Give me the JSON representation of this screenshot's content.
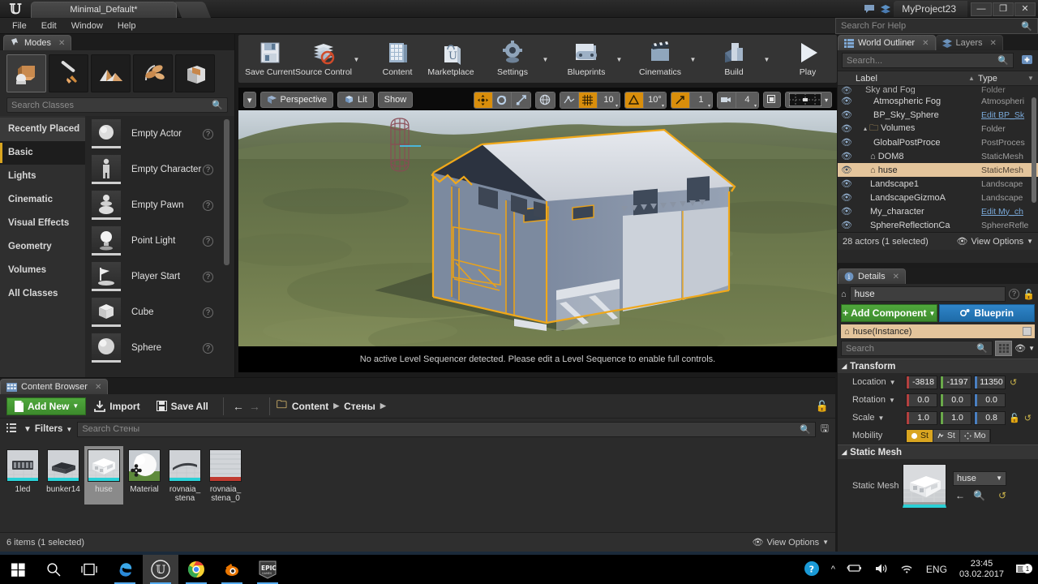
{
  "titlebar": {
    "level_tab": "Minimal_Default*",
    "project_name": "MyProject23",
    "minimize": "—",
    "maximize": "❐",
    "close": "✕",
    "chat_icon": "chat-icon",
    "cloud_icon": "layers-icon"
  },
  "menubar": {
    "items": [
      "File",
      "Edit",
      "Window",
      "Help"
    ]
  },
  "help_search": {
    "placeholder": "Search For Help",
    "icon": "search-icon"
  },
  "modes": {
    "tab_label": "Modes",
    "buttons": [
      "place-mode",
      "paint-mode",
      "landscape-mode",
      "foliage-mode",
      "geometry-mode"
    ],
    "search_placeholder": "Search Classes",
    "categories": [
      "Recently Placed",
      "Basic",
      "Lights",
      "Cinematic",
      "Visual Effects",
      "Geometry",
      "Volumes",
      "All Classes"
    ],
    "selected_category": "Basic",
    "assets": [
      "Empty Actor",
      "Empty Character",
      "Empty Pawn",
      "Point Light",
      "Player Start",
      "Cube",
      "Sphere"
    ]
  },
  "toolbar": {
    "items": [
      {
        "label": "Save Current",
        "icon": "save-icon",
        "caret": false
      },
      {
        "label": "Source Control",
        "icon": "source-control-icon",
        "caret": true
      },
      {
        "label": "Content",
        "icon": "content-icon",
        "caret": false
      },
      {
        "label": "Marketplace",
        "icon": "marketplace-icon",
        "caret": false
      },
      {
        "label": "Settings",
        "icon": "settings-gear-icon",
        "caret": true
      },
      {
        "label": "Blueprints",
        "icon": "blueprints-icon",
        "caret": true
      },
      {
        "label": "Cinematics",
        "icon": "cinematics-icon",
        "caret": true
      },
      {
        "label": "Build",
        "icon": "build-icon",
        "caret": true
      },
      {
        "label": "Play",
        "icon": "play-icon",
        "caret": true
      }
    ],
    "overflow": "»"
  },
  "viewport": {
    "view_caret": "▾",
    "perspective": "Perspective",
    "lit": "Lit",
    "show": "Show",
    "grid_snap_value": "10",
    "rotation_snap_value": "10°",
    "scale_snap_value": "1",
    "camera_speed_value": "4",
    "message": "No active Level Sequencer detected. Please edit a Level Sequence to enable full controls."
  },
  "outliner": {
    "tabs": [
      {
        "label": "World Outliner",
        "active": true
      },
      {
        "label": "Layers",
        "active": false
      }
    ],
    "search_placeholder": "Search...",
    "columns": {
      "label": "Label",
      "type": "Type"
    },
    "rows": [
      {
        "label": "Sky and Fog",
        "type": "Folder",
        "indent": 10,
        "icon": "folder-icon",
        "selected": false,
        "partial": true
      },
      {
        "label": "Atmospheric Fog",
        "type": "Atmospheri",
        "indent": 20,
        "icon": "fog-icon",
        "selected": false
      },
      {
        "label": "BP_Sky_Sphere",
        "type": "Edit BP_Sk",
        "indent": 20,
        "icon": "sphere-icon",
        "selected": false,
        "link": true
      },
      {
        "label": "Volumes",
        "type": "Folder",
        "indent": 8,
        "icon": "folder-icon",
        "selected": false
      },
      {
        "label": "GlobalPostProce",
        "type": "PostProces",
        "indent": 20,
        "icon": "volume-icon",
        "selected": false
      },
      {
        "label": "DOM8",
        "type": "StaticMesh",
        "indent": 14,
        "icon": "mesh-icon",
        "selected": false
      },
      {
        "label": "huse",
        "type": "StaticMesh",
        "indent": 14,
        "icon": "mesh-icon",
        "selected": true
      },
      {
        "label": "Landscape1",
        "type": "Landscape",
        "indent": 14,
        "icon": "landscape-icon",
        "selected": false
      },
      {
        "label": "LandscapeGizmoA",
        "type": "Landscape",
        "indent": 14,
        "icon": "gizmo-icon",
        "selected": false
      },
      {
        "label": "My_character",
        "type": "Edit My_ch",
        "indent": 14,
        "icon": "character-icon",
        "selected": false,
        "link": true
      },
      {
        "label": "SphereReflectionCa",
        "type": "SphereRefle",
        "indent": 14,
        "icon": "reflection-icon",
        "selected": false
      }
    ],
    "footer_count": "28 actors (1 selected)",
    "view_options": "View Options"
  },
  "details": {
    "tab_label": "Details",
    "actor_name": "huse",
    "add_component": "Add Component",
    "blueprint_button": "Blueprin",
    "instance_row": "huse(Instance)",
    "search_placeholder": "Search",
    "sections": {
      "transform": "Transform",
      "static_mesh": "Static Mesh"
    },
    "transform": {
      "location_label": "Location",
      "location": [
        "-3818",
        "-1197",
        "11350"
      ],
      "rotation_label": "Rotation",
      "rotation": [
        "0.0",
        "0.0",
        "0.0"
      ],
      "scale_label": "Scale",
      "scale": [
        "1.0",
        "1.0",
        "0.8"
      ],
      "mobility_label": "Mobility",
      "mobility": [
        "St",
        "St",
        "Mo"
      ],
      "mobility_selected": 0
    },
    "static_mesh": {
      "label": "Static Mesh",
      "value": "huse"
    }
  },
  "content_browser": {
    "tab_label": "Content Browser",
    "add_new": "Add New",
    "import": "Import",
    "save_all": "Save All",
    "breadcrumb": [
      "Content",
      "Стены"
    ],
    "filters": "Filters",
    "search_placeholder": "Search Стены",
    "items": [
      {
        "name": "1led",
        "thumb": "mesh-dark"
      },
      {
        "name": "bunker14",
        "thumb": "mesh-bunker"
      },
      {
        "name": "huse",
        "thumb": "mesh-house",
        "selected": true
      },
      {
        "name": "Material",
        "thumb": "material-sphere"
      },
      {
        "name": "rovnaia_\nstena",
        "thumb": "mesh-wall"
      },
      {
        "name": "rovnaia_\nstena_0",
        "thumb": "mesh-wall-red"
      }
    ],
    "footer_count": "6 items (1 selected)",
    "view_options": "View Options"
  },
  "taskbar": {
    "items": [
      {
        "name": "start-button",
        "glyph": "windows"
      },
      {
        "name": "search-button",
        "glyph": "search"
      },
      {
        "name": "task-view-button",
        "glyph": "taskview"
      },
      {
        "name": "edge-app",
        "glyph": "edge"
      },
      {
        "name": "unreal-app",
        "glyph": "unreal",
        "active": true
      },
      {
        "name": "chrome-app",
        "glyph": "chrome"
      },
      {
        "name": "blender-app",
        "glyph": "blender"
      },
      {
        "name": "epic-app",
        "glyph": "epic"
      }
    ],
    "tray": {
      "help": "?",
      "chevron": "^",
      "battery": "battery-icon",
      "volume": "volume-icon",
      "wifi": "wifi-icon",
      "lang": "ENG"
    },
    "time": "23:45",
    "date": "03.02.2017",
    "notification_count": "1"
  },
  "colors": {
    "accent_orange": "#d9a520",
    "green": "#4fa83c",
    "blue": "#2f85c9",
    "selection": "#e4c59c",
    "panel_bg": "#282828"
  }
}
